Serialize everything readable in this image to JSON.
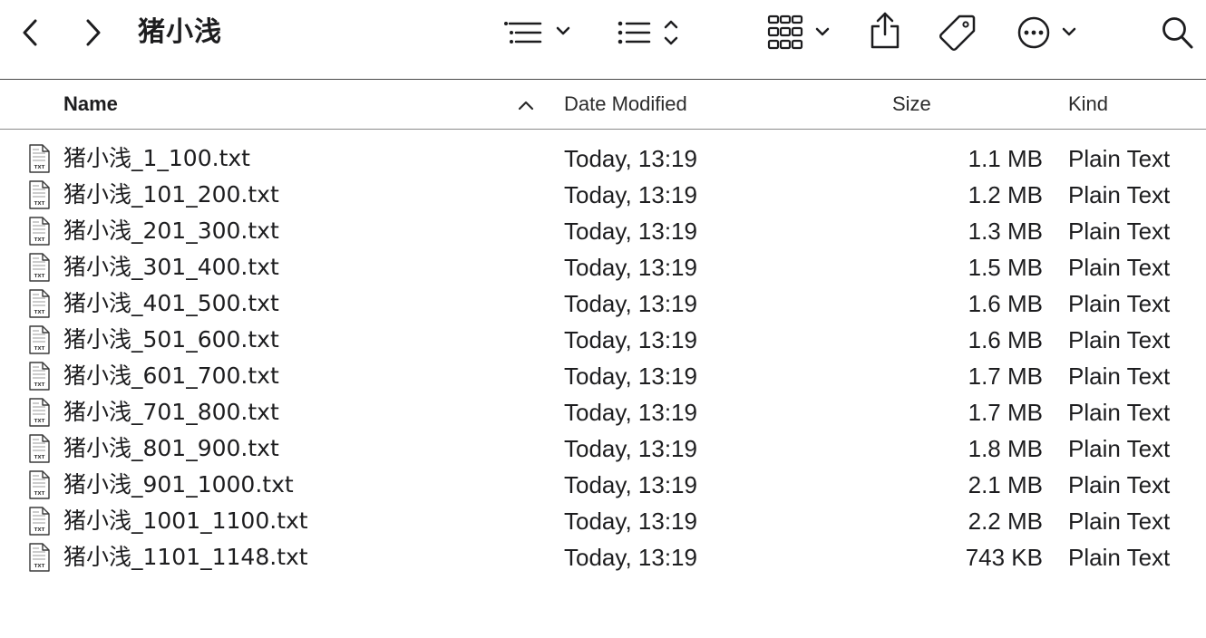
{
  "window": {
    "title": "猪小浅"
  },
  "toolbar": {
    "back_icon": "chevron-left-icon",
    "forward_icon": "chevron-right-icon",
    "group_icon": "list-group-icon",
    "sort_icon": "list-sort-icon",
    "view_icon": "grid-view-icon",
    "share_icon": "share-icon",
    "tag_icon": "tag-icon",
    "more_icon": "ellipsis-circle-icon",
    "search_icon": "search-icon"
  },
  "columns": {
    "name": "Name",
    "date": "Date Modified",
    "size": "Size",
    "kind": "Kind"
  },
  "files": [
    {
      "name": "猪小浅_1_100.txt",
      "date": "Today, 13:19",
      "size": "1.1 MB",
      "kind": "Plain Text"
    },
    {
      "name": "猪小浅_101_200.txt",
      "date": "Today, 13:19",
      "size": "1.2 MB",
      "kind": "Plain Text"
    },
    {
      "name": "猪小浅_201_300.txt",
      "date": "Today, 13:19",
      "size": "1.3 MB",
      "kind": "Plain Text"
    },
    {
      "name": "猪小浅_301_400.txt",
      "date": "Today, 13:19",
      "size": "1.5 MB",
      "kind": "Plain Text"
    },
    {
      "name": "猪小浅_401_500.txt",
      "date": "Today, 13:19",
      "size": "1.6 MB",
      "kind": "Plain Text"
    },
    {
      "name": "猪小浅_501_600.txt",
      "date": "Today, 13:19",
      "size": "1.6 MB",
      "kind": "Plain Text"
    },
    {
      "name": "猪小浅_601_700.txt",
      "date": "Today, 13:19",
      "size": "1.7 MB",
      "kind": "Plain Text"
    },
    {
      "name": "猪小浅_701_800.txt",
      "date": "Today, 13:19",
      "size": "1.7 MB",
      "kind": "Plain Text"
    },
    {
      "name": "猪小浅_801_900.txt",
      "date": "Today, 13:19",
      "size": "1.8 MB",
      "kind": "Plain Text"
    },
    {
      "name": "猪小浅_901_1000.txt",
      "date": "Today, 13:19",
      "size": "2.1 MB",
      "kind": "Plain Text"
    },
    {
      "name": "猪小浅_1001_1100.txt",
      "date": "Today, 13:19",
      "size": "2.2 MB",
      "kind": "Plain Text"
    },
    {
      "name": "猪小浅_1101_1148.txt",
      "date": "Today, 13:19",
      "size": "743 KB",
      "kind": "Plain Text"
    }
  ]
}
